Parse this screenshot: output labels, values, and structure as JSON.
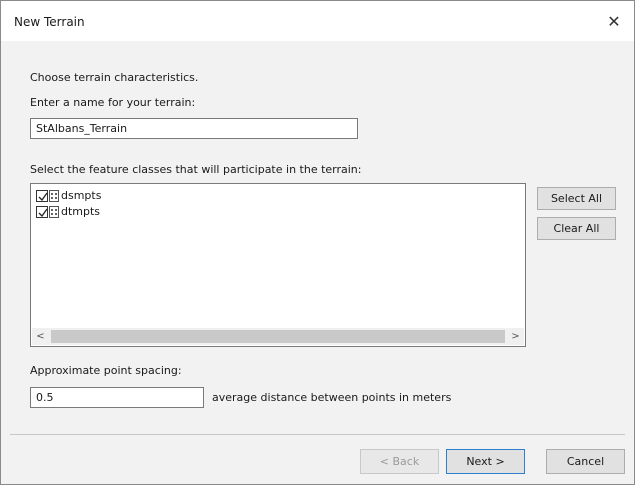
{
  "window": {
    "title": "New Terrain",
    "close_icon": "close-icon"
  },
  "intro": "Choose terrain characteristics.",
  "name_prompt": "Enter a name for your terrain:",
  "terrain_name": "StAlbans_Terrain",
  "feature_prompt": "Select the feature classes that will participate in the terrain:",
  "feature_classes": [
    {
      "label": "dsmpts",
      "checked": true,
      "icon": "point-feature-class-icon"
    },
    {
      "label": "dtmpts",
      "checked": true,
      "icon": "point-feature-class-icon"
    }
  ],
  "buttons": {
    "select_all": "Select All",
    "clear_all": "Clear All",
    "back": "< Back",
    "next": "Next >",
    "cancel": "Cancel"
  },
  "spacing": {
    "label": "Approximate point spacing:",
    "value": "0.5",
    "units_note": "average distance between points in meters"
  },
  "scroll_arrows": {
    "left": "<",
    "right": ">"
  }
}
